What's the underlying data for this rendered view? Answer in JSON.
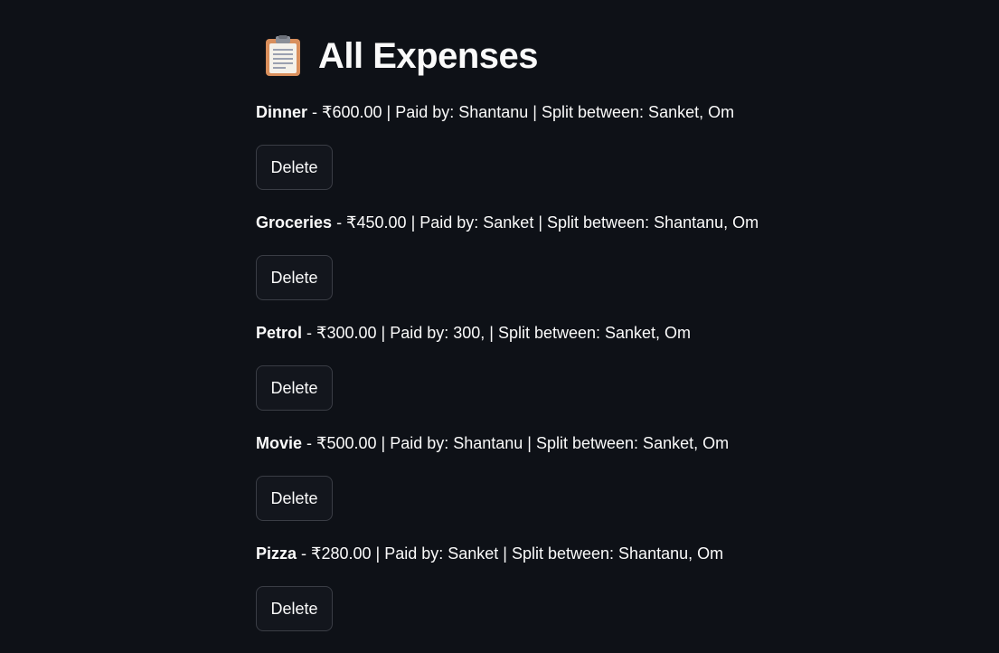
{
  "page": {
    "title_icon": "clipboard-icon",
    "title": "All Expenses"
  },
  "expenses": [
    {
      "name": "Dinner",
      "detail": " - ₹600.00 | Paid by: Shantanu | Split between: Sanket, Om",
      "delete_label": "Delete"
    },
    {
      "name": "Groceries",
      "detail": " - ₹450.00 | Paid by: Sanket | Split between: Shantanu, Om",
      "delete_label": "Delete"
    },
    {
      "name": "Petrol",
      "detail": " - ₹300.00 | Paid by: 300, | Split between: Sanket, Om",
      "delete_label": "Delete"
    },
    {
      "name": "Movie",
      "detail": " - ₹500.00 | Paid by: Shantanu | Split between: Sanket, Om",
      "delete_label": "Delete"
    },
    {
      "name": "Pizza",
      "detail": " - ₹280.00 | Paid by: Sanket | Split between: Shantanu, Om",
      "delete_label": "Delete"
    }
  ],
  "colors": {
    "background": "#0e1117",
    "text": "#fafafa",
    "button_bg": "#13161d",
    "button_border": "#3a3d45"
  }
}
